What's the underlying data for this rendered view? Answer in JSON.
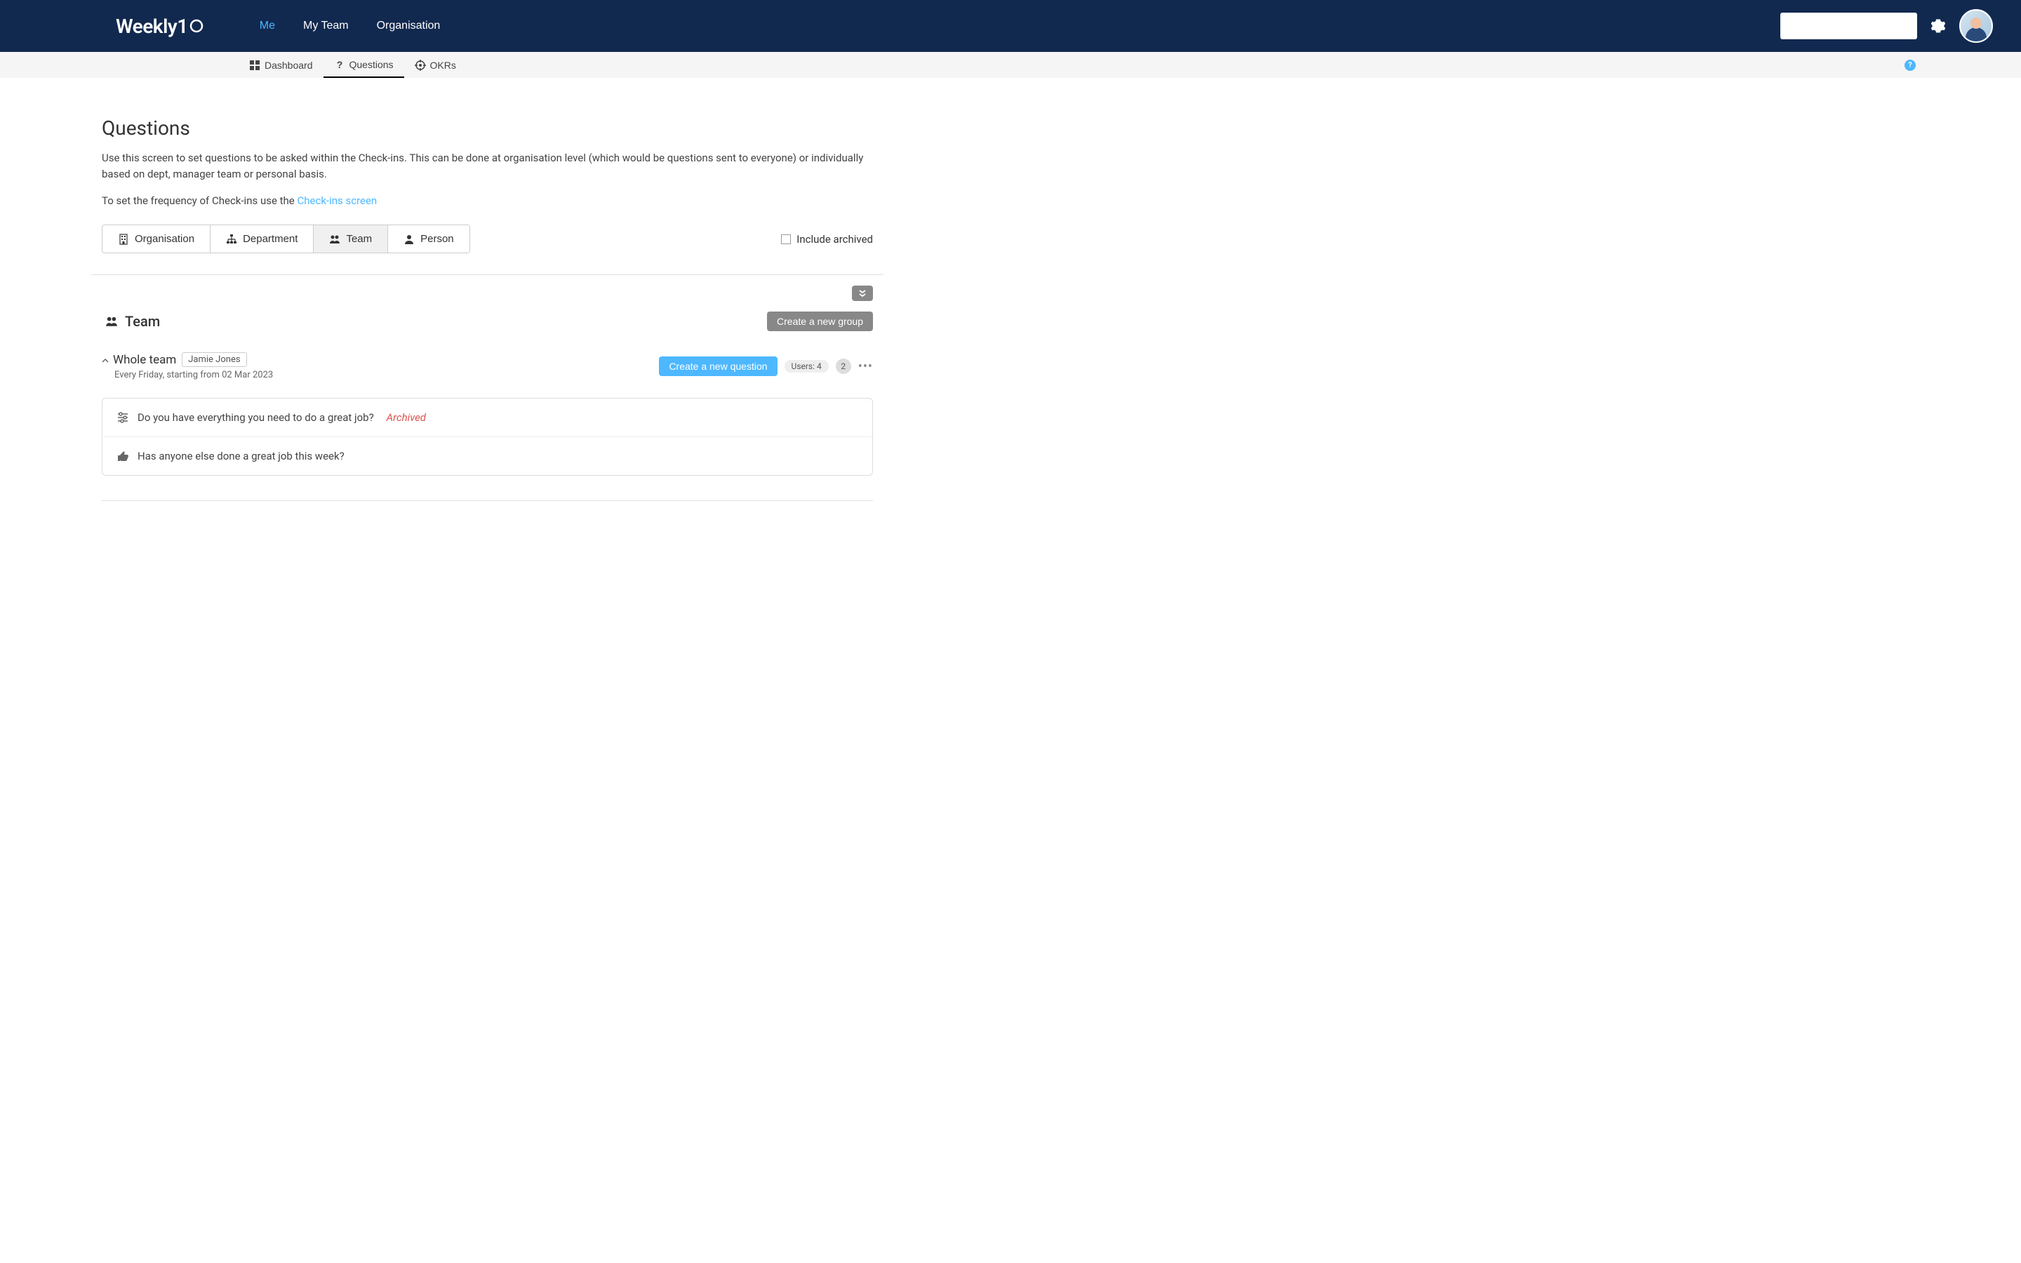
{
  "header": {
    "logo": "Weekly10",
    "nav": {
      "me": "Me",
      "my_team": "My Team",
      "organisation": "Organisation"
    }
  },
  "subnav": {
    "dashboard": "Dashboard",
    "questions": "Questions",
    "okrs": "OKRs"
  },
  "page": {
    "title": "Questions",
    "description": "Use this screen to set questions to be asked within the Check-ins. This can be done at organisation level (which would be questions sent to everyone) or individually based on dept, manager team or personal basis.",
    "frequency_text_prefix": "To set the frequency of Check-ins use the ",
    "frequency_link": "Check-ins screen"
  },
  "filter_tabs": {
    "organisation": "Organisation",
    "department": "Department",
    "team": "Team",
    "person": "Person"
  },
  "include_archived_label": "Include archived",
  "section": {
    "title": "Team",
    "create_group_btn": "Create a new group"
  },
  "group": {
    "name": "Whole team",
    "owner": "Jamie Jones",
    "schedule": "Every Friday, starting from 02 Mar 2023",
    "create_question_btn": "Create a new question",
    "users_label": "Users: 4",
    "count": "2",
    "questions": [
      {
        "text": "Do you have everything you need to do a great job?",
        "archived": true,
        "archived_label": "Archived"
      },
      {
        "text": "Has anyone else done a great job this week?",
        "archived": false
      }
    ]
  }
}
